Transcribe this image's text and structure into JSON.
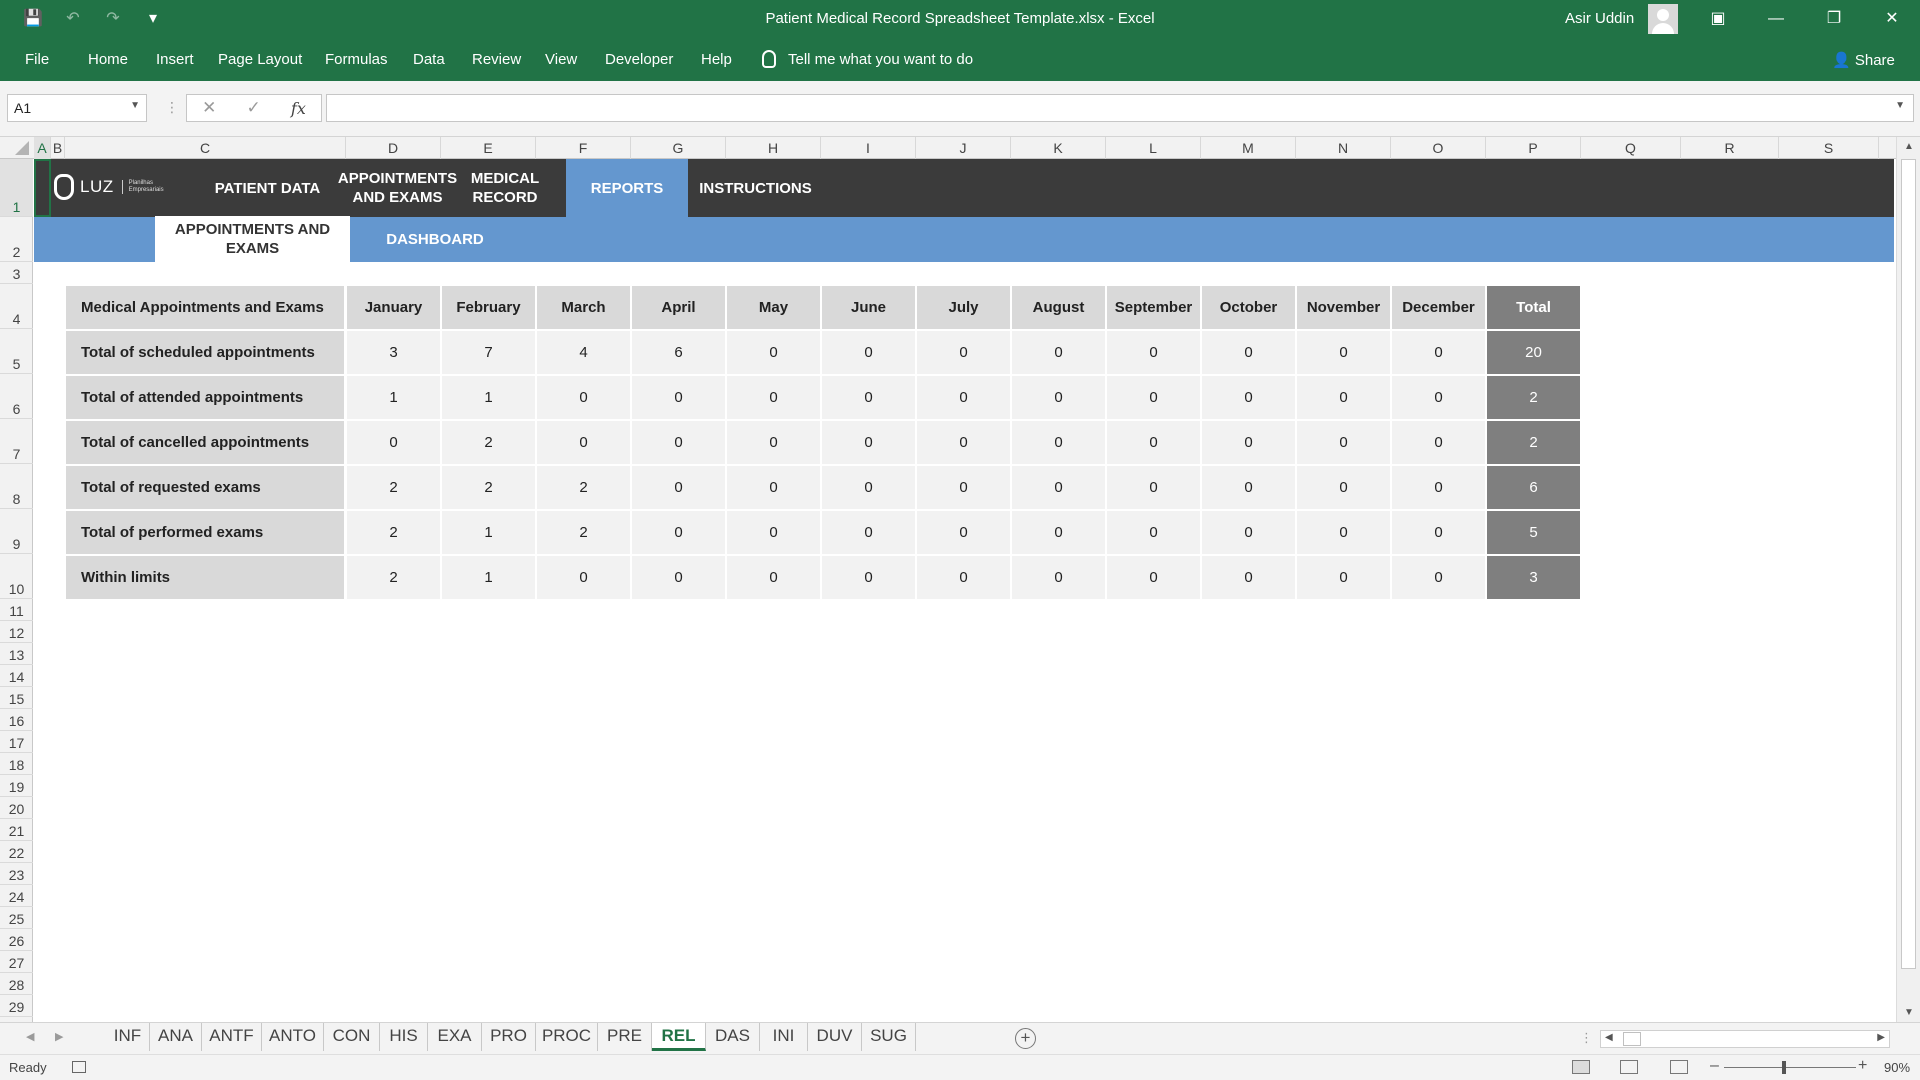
{
  "window": {
    "title": "Patient Medical Record Spreadsheet Template.xlsx  -  Excel",
    "user": "Asir Uddin"
  },
  "ribbon": {
    "tabs": [
      "File",
      "Home",
      "Insert",
      "Page Layout",
      "Formulas",
      "Data",
      "Review",
      "View",
      "Developer",
      "Help"
    ],
    "tell_me": "Tell me what you want to do",
    "share": "Share"
  },
  "formula_bar": {
    "name_box": "A1",
    "fx": "fx",
    "formula": ""
  },
  "grid": {
    "columns": [
      "A",
      "B",
      "C",
      "D",
      "E",
      "F",
      "G",
      "H",
      "I",
      "J",
      "K",
      "L",
      "M",
      "N",
      "O",
      "P",
      "Q",
      "R",
      "S"
    ],
    "rows": [
      "1",
      "2",
      "3",
      "4",
      "5",
      "6",
      "7",
      "8",
      "9",
      "10",
      "11",
      "12",
      "13",
      "14",
      "15",
      "16",
      "17",
      "18",
      "19",
      "20",
      "21",
      "22",
      "23",
      "24",
      "25",
      "26",
      "27",
      "28",
      "29"
    ]
  },
  "sheet_nav": {
    "logo_text": "LUZ",
    "logo_sub": [
      "Planilhas",
      "Empresariais"
    ],
    "items": [
      "PATIENT DATA",
      "APPOINTMENTS AND EXAMS",
      "MEDICAL RECORD",
      "REPORTS",
      "INSTRUCTIONS"
    ],
    "active_item": "REPORTS",
    "subitems": [
      "APPOINTMENTS AND EXAMS",
      "DASHBOARD"
    ],
    "active_subitem": "APPOINTMENTS AND EXAMS"
  },
  "report": {
    "header": [
      "Medical Appointments and Exams",
      "January",
      "February",
      "March",
      "April",
      "May",
      "June",
      "July",
      "August",
      "September",
      "October",
      "November",
      "December",
      "Total"
    ],
    "rows": [
      {
        "label": "Total of scheduled appointments",
        "values": [
          "3",
          "7",
          "4",
          "6",
          "0",
          "0",
          "0",
          "0",
          "0",
          "0",
          "0",
          "0"
        ],
        "total": "20"
      },
      {
        "label": "Total of attended appointments",
        "values": [
          "1",
          "1",
          "0",
          "0",
          "0",
          "0",
          "0",
          "0",
          "0",
          "0",
          "0",
          "0"
        ],
        "total": "2"
      },
      {
        "label": "Total of cancelled appointments",
        "values": [
          "0",
          "2",
          "0",
          "0",
          "0",
          "0",
          "0",
          "0",
          "0",
          "0",
          "0",
          "0"
        ],
        "total": "2"
      },
      {
        "label": "Total of requested exams",
        "values": [
          "2",
          "2",
          "2",
          "0",
          "0",
          "0",
          "0",
          "0",
          "0",
          "0",
          "0",
          "0"
        ],
        "total": "6"
      },
      {
        "label": "Total of performed exams",
        "values": [
          "2",
          "1",
          "2",
          "0",
          "0",
          "0",
          "0",
          "0",
          "0",
          "0",
          "0",
          "0"
        ],
        "total": "5"
      },
      {
        "label": "Within limits",
        "values": [
          "2",
          "1",
          "0",
          "0",
          "0",
          "0",
          "0",
          "0",
          "0",
          "0",
          "0",
          "0"
        ],
        "total": "3"
      }
    ]
  },
  "sheet_tabs": {
    "tabs": [
      "INF",
      "ANA",
      "ANTF",
      "ANTO",
      "CON",
      "HIS",
      "EXA",
      "PRO",
      "PROC",
      "PRE",
      "REL",
      "DAS",
      "INI",
      "DUV",
      "SUG"
    ],
    "active": "REL"
  },
  "status": {
    "ready": "Ready",
    "zoom": "90%"
  },
  "colors": {
    "excel_green": "#217346",
    "nav_dark": "#3b3b3b",
    "nav_blue": "#6497cf",
    "header_gray": "#d9d9d9",
    "value_gray": "#f2f2f2",
    "total_gray": "#7f7f7f"
  }
}
